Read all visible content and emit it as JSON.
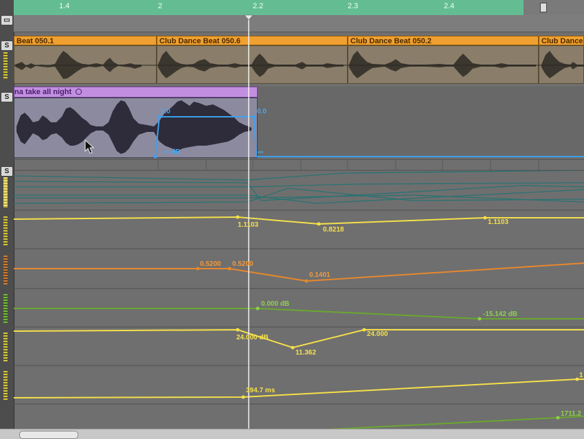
{
  "ruler": {
    "markers": [
      "1.4",
      "2",
      "2.2",
      "2.3",
      "2.4"
    ]
  },
  "tracks": {
    "solo_label": "S",
    "drum_regions": [
      {
        "label": "Beat 050.1"
      },
      {
        "label": "Club Dance Beat 050.6"
      },
      {
        "label": "Club Dance Beat 050.2"
      },
      {
        "label": "Club Dance"
      }
    ],
    "vocal_region": {
      "label": "na take all night",
      "fade_top_left": "0.0",
      "fade_top_right": "0.0",
      "fade_bottom": "-∞ dB",
      "fade_right_bottom": "-∞"
    }
  },
  "automation": {
    "lane1": {
      "labels": [
        "1.1103",
        "0.8218",
        "1.1103"
      ]
    },
    "lane2": {
      "labels": [
        "0.5200",
        "0.5200",
        "0.1401"
      ]
    },
    "lane3": {
      "labels": [
        "0.000 dB",
        "-15.142 dB"
      ]
    },
    "lane4": {
      "labels": [
        "24.000 dB",
        "11.362",
        "24.000"
      ]
    },
    "lane5": {
      "labels": [
        "394.7 ms",
        "1"
      ]
    },
    "lane6": {
      "labels": [
        "1711.2"
      ]
    }
  },
  "colors": {
    "ruler": "#64bd92",
    "drum_region": "#f0a030",
    "vocal_region": "#c28fe0",
    "yellow_automation": "#f5e04a",
    "orange_automation": "#f09a3c",
    "green_automation": "#79b93a",
    "teal_automation": "#2a6f6f"
  }
}
